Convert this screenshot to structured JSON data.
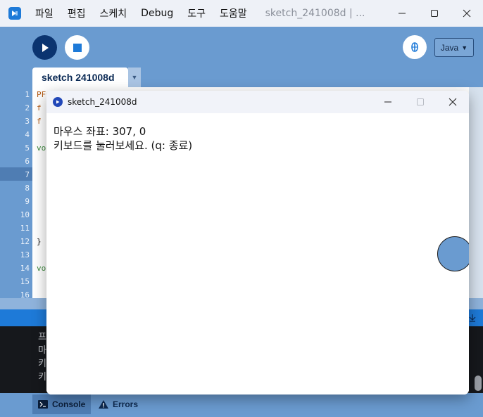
{
  "ide": {
    "menu": [
      "파일",
      "편집",
      "스케치",
      "Debug",
      "도구",
      "도움말"
    ],
    "window_title": "sketch_241008d | ...",
    "mode": "Java",
    "tab_label": "sketch 241008d",
    "line_numbers": [
      "1",
      "2",
      "3",
      "4",
      "5",
      "6",
      "7",
      "8",
      "9",
      "10",
      "11",
      "12",
      "13",
      "14",
      "15",
      "16"
    ],
    "code_lines": [
      {
        "text": "PFo",
        "color": "#b35a14"
      },
      {
        "text": "f lo",
        "color": "#b35a14"
      },
      {
        "text": "f lo",
        "color": "#b35a14"
      },
      {
        "text": "",
        "color": "#333333"
      },
      {
        "text": "vo",
        "color": "#3d8a3d"
      },
      {
        "text": "  ",
        "color": "#333333"
      },
      {
        "text": "  ",
        "color": "#333333"
      },
      {
        "text": "  ",
        "color": "#333333"
      },
      {
        "text": "  ",
        "color": "#333333"
      },
      {
        "text": "  ",
        "color": "#333333"
      },
      {
        "text": "  ",
        "color": "#333333"
      },
      {
        "text": "}",
        "color": "#111111"
      },
      {
        "text": "",
        "color": "#333333"
      },
      {
        "text": "vo",
        "color": "#3d8a3d"
      },
      {
        "text": "  ",
        "color": "#333333"
      },
      {
        "text": "",
        "color": "#333333"
      }
    ],
    "console_lines": [
      "프",
      "마",
      "키",
      "키"
    ],
    "console_tab": "Console",
    "errors_tab": "Errors"
  },
  "sketch": {
    "title": "sketch_241008d",
    "line1": "마우스 좌표: 307, 0",
    "line2": "키보드를 눌러보세요. (q: 종료)",
    "circle_color": "#6a9bd0"
  },
  "colors": {
    "toolbar": "#6a9bd0",
    "run": "#0b3470",
    "console_bar": "#1e7ad8"
  }
}
